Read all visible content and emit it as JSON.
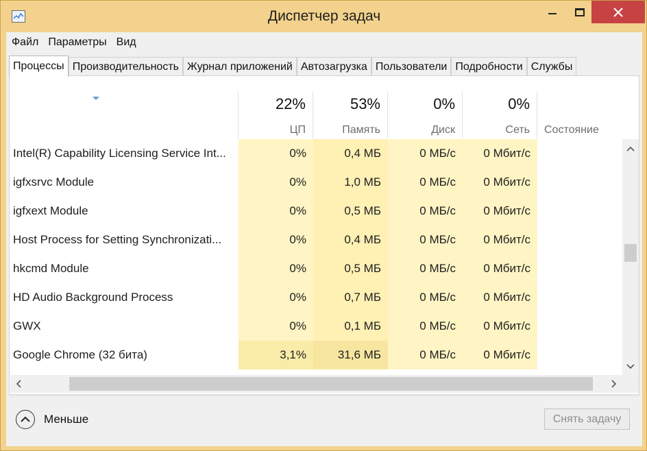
{
  "window": {
    "title": "Диспетчер задач",
    "close_color": "#c74343",
    "frame_color": "#f2d28c"
  },
  "menu": [
    "Файл",
    "Параметры",
    "Вид"
  ],
  "tabs": [
    {
      "label": "Процессы",
      "active": true
    },
    {
      "label": "Производительность"
    },
    {
      "label": "Журнал приложений"
    },
    {
      "label": "Автозагрузка"
    },
    {
      "label": "Пользователи"
    },
    {
      "label": "Подробности"
    },
    {
      "label": "Службы"
    }
  ],
  "columns": {
    "cpu": {
      "percent": "22%",
      "label": "ЦП"
    },
    "memory": {
      "percent": "53%",
      "label": "Память"
    },
    "disk": {
      "percent": "0%",
      "label": "Диск"
    },
    "network": {
      "percent": "0%",
      "label": "Сеть"
    },
    "state": {
      "label": "Состояние"
    }
  },
  "rows": [
    {
      "name": "Intel(R) Capability Licensing Service Int...",
      "cpu": "0%",
      "memory": "0,4 МБ",
      "disk": "0 МБ/с",
      "network": "0 Мбит/с"
    },
    {
      "name": "igfxsrvc Module",
      "cpu": "0%",
      "memory": "1,0 МБ",
      "disk": "0 МБ/с",
      "network": "0 Мбит/с"
    },
    {
      "name": "igfxext Module",
      "cpu": "0%",
      "memory": "0,5 МБ",
      "disk": "0 МБ/с",
      "network": "0 Мбит/с"
    },
    {
      "name": "Host Process for Setting Synchronizati...",
      "cpu": "0%",
      "memory": "0,4 МБ",
      "disk": "0 МБ/с",
      "network": "0 Мбит/с"
    },
    {
      "name": "hkcmd Module",
      "cpu": "0%",
      "memory": "0,5 МБ",
      "disk": "0 МБ/с",
      "network": "0 Мбит/с"
    },
    {
      "name": "HD Audio Background Process",
      "cpu": "0%",
      "memory": "0,7 МБ",
      "disk": "0 МБ/с",
      "network": "0 Мбит/с"
    },
    {
      "name": "GWX",
      "cpu": "0%",
      "memory": "0,1 МБ",
      "disk": "0 МБ/с",
      "network": "0 Мбит/с"
    },
    {
      "name": "Google Chrome (32 бита)",
      "cpu": "3,1%",
      "memory": "31,6 МБ",
      "disk": "0 МБ/с",
      "network": "0 Мбит/с"
    }
  ],
  "footer": {
    "less_label": "Меньше",
    "end_task_label": "Снять задачу"
  },
  "icons": {
    "app": "task-manager-icon",
    "minimize": "minimize-icon",
    "maximize": "maximize-icon",
    "close": "close-icon",
    "less": "chevron-up-circle-icon"
  }
}
